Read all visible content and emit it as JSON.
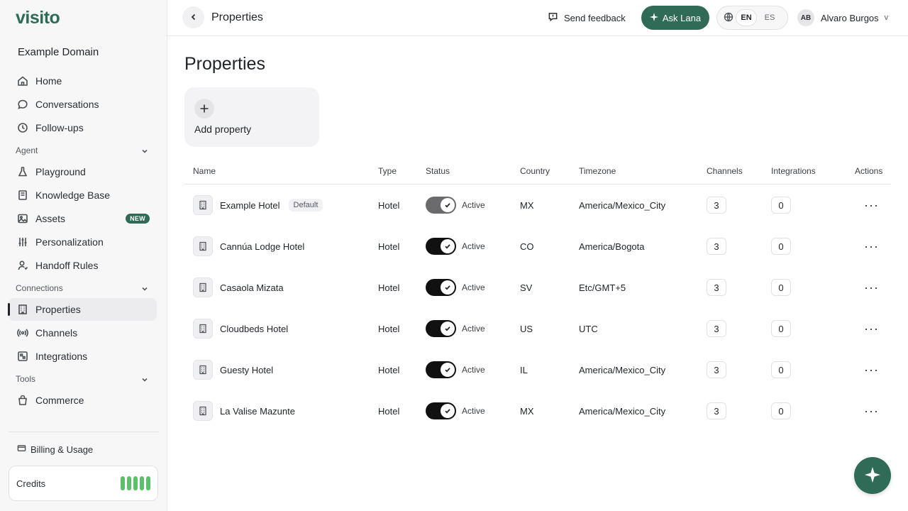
{
  "sidebar": {
    "logo": "visito",
    "domain": "Example Domain",
    "main_items": [
      {
        "label": "Home",
        "icon": "home-icon"
      },
      {
        "label": "Conversations",
        "icon": "chat-icon"
      },
      {
        "label": "Follow-ups",
        "icon": "clock-icon"
      }
    ],
    "agent_section": "Agent",
    "agent_items": [
      {
        "label": "Playground",
        "icon": "flask-icon"
      },
      {
        "label": "Knowledge Base",
        "icon": "book-icon"
      },
      {
        "label": "Assets",
        "icon": "image-icon",
        "badge": "NEW"
      },
      {
        "label": "Personalization",
        "icon": "sliders-icon"
      },
      {
        "label": "Handoff Rules",
        "icon": "user-icon"
      }
    ],
    "connections_section": "Connections",
    "connections_items": [
      {
        "label": "Properties",
        "icon": "building-icon",
        "active": true
      },
      {
        "label": "Channels",
        "icon": "broadcast-icon"
      },
      {
        "label": "Integrations",
        "icon": "puzzle-icon"
      }
    ],
    "tools_section": "Tools",
    "tools_items": [
      {
        "label": "Commerce",
        "icon": "bag-icon"
      }
    ],
    "billing_label": "Billing & Usage",
    "credits_label": "Credits"
  },
  "header": {
    "title": "Properties",
    "feedback_label": "Send feedback",
    "ask_label": "Ask Lana",
    "languages": [
      "EN",
      "ES"
    ],
    "selected_language": "EN",
    "user_initials": "AB",
    "user_name": "Alvaro Burgos",
    "user_caret": "v"
  },
  "main": {
    "title": "Properties",
    "add_label": "Add property",
    "columns": [
      "Name",
      "Type",
      "Status",
      "Country",
      "Timezone",
      "Channels",
      "Integrations",
      "Actions"
    ],
    "rows": [
      {
        "name": "Example Hotel",
        "tag": "Default",
        "type": "Hotel",
        "status": "Active",
        "country": "MX",
        "timezone": "America/Mexico_City",
        "channels": "3",
        "integrations": "0",
        "muted": true
      },
      {
        "name": "Cannúa Lodge Hotel",
        "tag": "",
        "type": "Hotel",
        "status": "Active",
        "country": "CO",
        "timezone": "America/Bogota",
        "channels": "3",
        "integrations": "0"
      },
      {
        "name": "Casaola Mizata",
        "tag": "",
        "type": "Hotel",
        "status": "Active",
        "country": "SV",
        "timezone": "Etc/GMT+5",
        "channels": "3",
        "integrations": "0"
      },
      {
        "name": "Cloudbeds Hotel",
        "tag": "",
        "type": "Hotel",
        "status": "Active",
        "country": "US",
        "timezone": "UTC",
        "channels": "3",
        "integrations": "0"
      },
      {
        "name": "Guesty Hotel",
        "tag": "",
        "type": "Hotel",
        "status": "Active",
        "country": "IL",
        "timezone": "America/Mexico_City",
        "channels": "3",
        "integrations": "0"
      },
      {
        "name": "La Valise Mazunte",
        "tag": "",
        "type": "Hotel",
        "status": "Active",
        "country": "MX",
        "timezone": "America/Mexico_City",
        "channels": "3",
        "integrations": "0"
      }
    ],
    "actions_glyph": "···"
  },
  "colors": {
    "brand": "#2f6b57",
    "credits": "#5cbf6a"
  }
}
